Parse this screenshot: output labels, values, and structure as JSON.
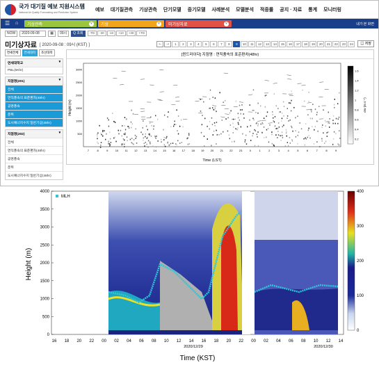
{
  "header": {
    "logo_title": "국가 대기질 예보 지원시스템",
    "logo_sub": "National Air Quality Forecasting and Prediction System",
    "menu": [
      "예보",
      "대기질관측",
      "기상관측",
      "단기모델",
      "중기모델",
      "사례분석",
      "모델분석",
      "적중률",
      "공지 · 자료",
      "통계",
      "모니터링"
    ]
  },
  "nav": {
    "menu_icon": "menu-icon",
    "home_icon": "home-icon",
    "crumbs": [
      {
        "label": "기상관측",
        "color": "#9bc53d"
      },
      {
        "label": "기상",
        "color": "#f2a51a"
      },
      {
        "label": "미기상자료",
        "color": "#e05243"
      }
    ],
    "right_label": "내가 본 화면"
  },
  "controls": {
    "now": "NOW",
    "date": "2020-09-08",
    "hour": "09시",
    "search": "Q 조회",
    "steps": [
      "-TD",
      "-30",
      "-10",
      "+10",
      "+30",
      "+TD"
    ]
  },
  "title": {
    "main": "미기상자료",
    "sub": "[ 2020-09-08 : 09시 (KST) ]",
    "hours": [
      "1",
      "2",
      "3",
      "4",
      "5",
      "6",
      "7",
      "8",
      "9",
      "10",
      "11",
      "12",
      "13",
      "14",
      "15",
      "16",
      "17",
      "18",
      "19",
      "20",
      "21",
      "22",
      "23",
      "24"
    ],
    "active_hour": "9",
    "save": "저장"
  },
  "sidebar": {
    "tabs": [
      "연세전체",
      "연세대학",
      "조선대학"
    ],
    "group1": {
      "title": "연세대학교",
      "items": [
        "PBL(5Khr)"
      ]
    },
    "group2": {
      "title": "지점명(201)",
      "items": [
        "전체",
        "연직풍속의 표준편차(48hr)",
        "공명풍속",
        "운위",
        "도시예너지수지 일반기상(48hr)"
      ],
      "selected": [
        "전체",
        "연직풍속의 표준편차(48hr)",
        "공명풍속",
        "운위",
        "도시예너지수지 일반기상(48hr)"
      ]
    },
    "group3": {
      "title": "지점명(202)",
      "items": [
        "전체",
        "연직풍속의 표준편차(48hr)",
        "공명풍속",
        "운위",
        "도시예너지수지 일반기상(48hr)"
      ]
    }
  },
  "panel": {
    "title": "[윈드라이다] 지점명 : 연직풍속의 표준편차(48hr)",
    "ylabel": "Height (m)",
    "xlabel": "Time (LST)",
    "colorbar_label": "σw (m s⁻¹)",
    "xticks": [
      "7",
      "8",
      "9",
      "10",
      "11",
      "12",
      "13",
      "14",
      "15",
      "16",
      "17",
      "18",
      "19",
      "20",
      "21",
      "22",
      "23",
      "0",
      "1",
      "2",
      "3",
      "4",
      "5",
      "6",
      "7",
      "8",
      "9"
    ],
    "yticks": [
      "500",
      "1000",
      "1500",
      "2000",
      "2500",
      "3000"
    ],
    "cbticks": [
      "0.2",
      "0.4",
      "0.6",
      "0.8",
      "1",
      "1.2",
      "1.4",
      "1.6"
    ]
  },
  "chart2": {
    "legend": "MLH",
    "ylabel": "Height (m)",
    "xlabel": "Time (KST)",
    "yticks": [
      "0",
      "500",
      "1000",
      "1500",
      "2000",
      "2500",
      "3000",
      "3500",
      "4000"
    ],
    "xticks": [
      "16",
      "18",
      "20",
      "22",
      "00",
      "02",
      "04",
      "06",
      "08",
      "10",
      "12",
      "14",
      "16",
      "18",
      "20",
      "22",
      "00",
      "02",
      "04",
      "06",
      "08",
      "10",
      "12",
      "14"
    ],
    "date_labels": [
      "2020/12/29",
      "2020/12/30"
    ],
    "cbticks": [
      "0",
      "100",
      "200",
      "300",
      "400"
    ]
  }
}
